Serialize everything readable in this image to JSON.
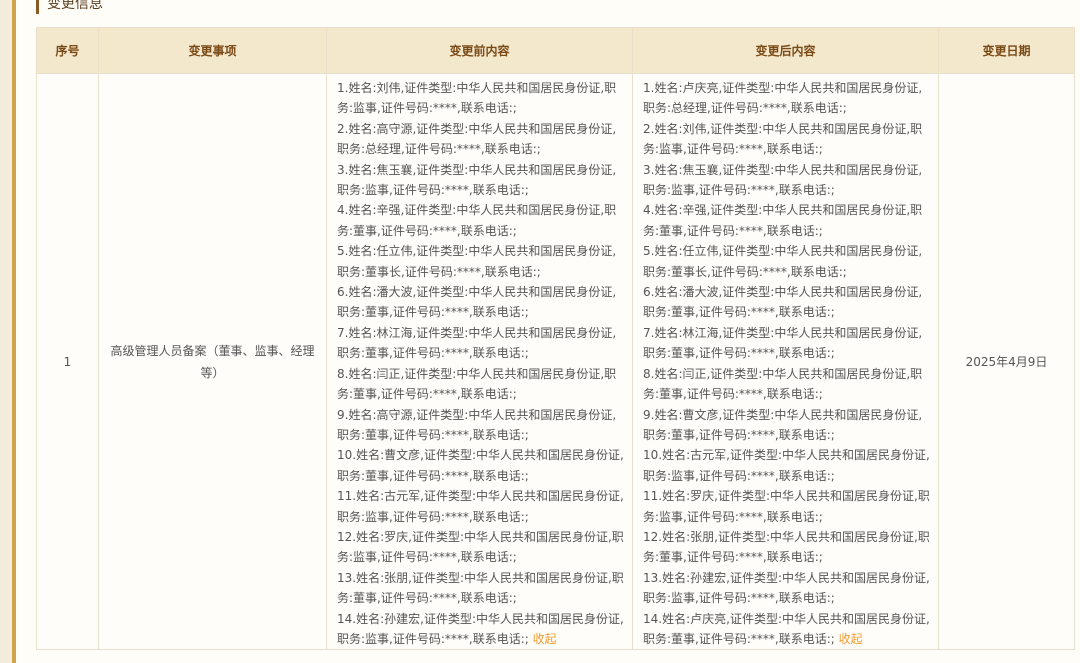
{
  "section": {
    "title": "变更信息"
  },
  "table": {
    "headers": {
      "seq": "序号",
      "item": "变更事项",
      "before": "变更前内容",
      "after": "变更后内容",
      "date": "变更日期"
    },
    "rows": [
      {
        "seq": "1",
        "item": "高级管理人员备案（董事、监事、经理等）",
        "date": "2025年4月9日",
        "before": [
          "1.姓名:刘伟,证件类型:中华人民共和国居民身份证,职务:监事,证件号码:****,联系电话:;",
          "2.姓名:高守源,证件类型:中华人民共和国居民身份证,职务:总经理,证件号码:****,联系电话:;",
          "3.姓名:焦玉襄,证件类型:中华人民共和国居民身份证,职务:监事,证件号码:****,联系电话:;",
          "4.姓名:辛强,证件类型:中华人民共和国居民身份证,职务:董事,证件号码:****,联系电话:;",
          "5.姓名:任立伟,证件类型:中华人民共和国居民身份证,职务:董事长,证件号码:****,联系电话:;",
          "6.姓名:潘大波,证件类型:中华人民共和国居民身份证,职务:董事,证件号码:****,联系电话:;",
          "7.姓名:林江海,证件类型:中华人民共和国居民身份证,职务:董事,证件号码:****,联系电话:;",
          "8.姓名:闫正,证件类型:中华人民共和国居民身份证,职务:董事,证件号码:****,联系电话:;",
          "9.姓名:高守源,证件类型:中华人民共和国居民身份证,职务:董事,证件号码:****,联系电话:;",
          "10.姓名:曹文彦,证件类型:中华人民共和国居民身份证,职务:董事,证件号码:****,联系电话:;",
          "11.姓名:古元军,证件类型:中华人民共和国居民身份证,职务:监事,证件号码:****,联系电话:;",
          "12.姓名:罗庆,证件类型:中华人民共和国居民身份证,职务:监事,证件号码:****,联系电话:;",
          "13.姓名:张朋,证件类型:中华人民共和国居民身份证,职务:董事,证件号码:****,联系电话:;",
          "14.姓名:孙建宏,证件类型:中华人民共和国居民身份证,职务:监事,证件号码:****,联系电话:;"
        ],
        "after": [
          "1.姓名:卢庆亮,证件类型:中华人民共和国居民身份证,职务:总经理,证件号码:****,联系电话:;",
          "2.姓名:刘伟,证件类型:中华人民共和国居民身份证,职务:监事,证件号码:****,联系电话:;",
          "3.姓名:焦玉襄,证件类型:中华人民共和国居民身份证,职务:监事,证件号码:****,联系电话:;",
          "4.姓名:辛强,证件类型:中华人民共和国居民身份证,职务:董事,证件号码:****,联系电话:;",
          "5.姓名:任立伟,证件类型:中华人民共和国居民身份证,职务:董事长,证件号码:****,联系电话:;",
          "6.姓名:潘大波,证件类型:中华人民共和国居民身份证,职务:董事,证件号码:****,联系电话:;",
          "7.姓名:林江海,证件类型:中华人民共和国居民身份证,职务:董事,证件号码:****,联系电话:;",
          "8.姓名:闫正,证件类型:中华人民共和国居民身份证,职务:董事,证件号码:****,联系电话:;",
          "9.姓名:曹文彦,证件类型:中华人民共和国居民身份证,职务:董事,证件号码:****,联系电话:;",
          "10.姓名:古元军,证件类型:中华人民共和国居民身份证,职务:监事,证件号码:****,联系电话:;",
          "11.姓名:罗庆,证件类型:中华人民共和国居民身份证,职务:监事,证件号码:****,联系电话:;",
          "12.姓名:张朋,证件类型:中华人民共和国居民身份证,职务:董事,证件号码:****,联系电话:;",
          "13.姓名:孙建宏,证件类型:中华人民共和国居民身份证,职务:监事,证件号码:****,联系电话:;",
          "14.姓名:卢庆亮,证件类型:中华人民共和国居民身份证,职务:董事,证件号码:****,联系电话:;"
        ],
        "collapse_label": "收起"
      }
    ]
  },
  "colors": {
    "accent": "#d2a34f",
    "header_bg": "#f3e7cc",
    "header_text": "#7a4a16",
    "link": "#f39a2d"
  }
}
